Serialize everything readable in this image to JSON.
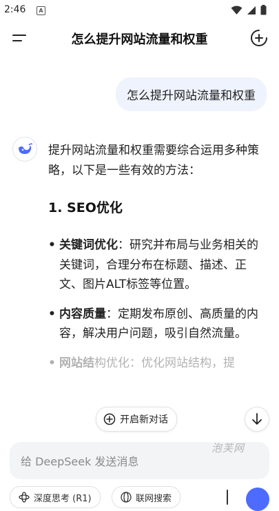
{
  "status_bar": {
    "time": "2:46",
    "notif_letter": "A"
  },
  "header": {
    "title": "怎么提升网站流量和权重"
  },
  "user_message": "怎么提升网站流量和权重",
  "answer": {
    "intro": "提升网站流量和权重需要综合运用多种策略，以下是一些有效的方法：",
    "section_heading": "1. SEO优化",
    "bullets": [
      {
        "term": "关键词优化",
        "text": "：研究并布局与业务相关的关键词，合理分布在标题、描述、正文、图片ALT标签等位置。"
      },
      {
        "term": "内容质量",
        "text": "：定期发布原创、高质量的内容，解决用户问题，吸引自然流量。"
      },
      {
        "term": "网站结",
        "text": "构优化：优化网站结构，提"
      }
    ]
  },
  "new_chat_pill": "开启新对话",
  "watermark": "泡芙网",
  "input": {
    "placeholder": "给 DeepSeek 发送消息"
  },
  "chips": {
    "deep_think": "深度思考 (R1)",
    "web_search": "联网搜索"
  },
  "accent_color": "#4d6bfe"
}
